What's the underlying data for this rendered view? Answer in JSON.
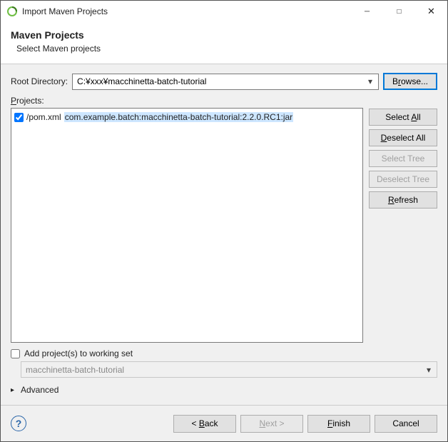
{
  "window": {
    "title": "Import Maven Projects"
  },
  "header": {
    "heading": "Maven Projects",
    "subtitle": "Select Maven projects"
  },
  "rootdir": {
    "label": "Root Directory:",
    "value": "C:¥xxx¥macchinetta-batch-tutorial",
    "browse": "Browse..."
  },
  "projects": {
    "label": "Projects:",
    "items": [
      {
        "checked": true,
        "path": "/pom.xml",
        "artifact": "com.example.batch:macchinetta-batch-tutorial:2.2.0.RC1:jar"
      }
    ],
    "buttons": {
      "selectAll": "Select All",
      "deselectAll": "Deselect All",
      "selectTree": "Select Tree",
      "deselectTree": "Deselect Tree",
      "refresh": "Refresh"
    }
  },
  "workingset": {
    "checkbox_label": "Add project(s) to working set",
    "checked": false,
    "value": "macchinetta-batch-tutorial"
  },
  "advanced": {
    "label": "Advanced"
  },
  "bottom": {
    "back": "< Back",
    "next": "Next >",
    "finish": "Finish",
    "cancel": "Cancel"
  }
}
